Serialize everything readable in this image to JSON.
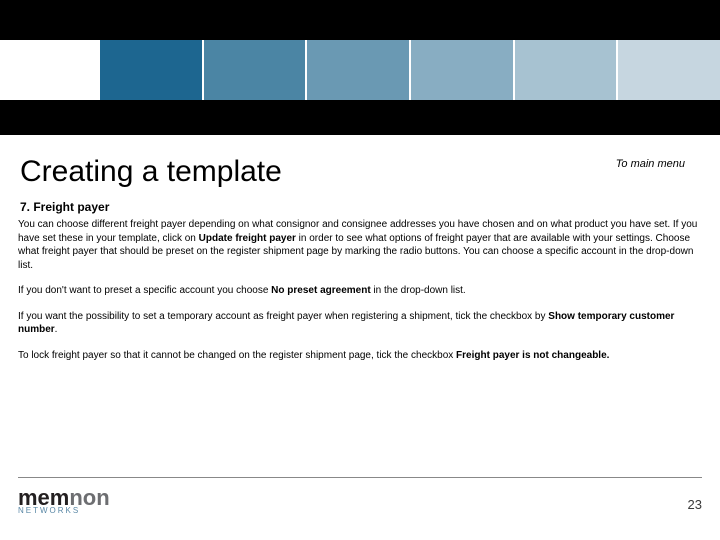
{
  "colors": {
    "seg1": "#1d6690",
    "seg2": "#4b85a4",
    "seg3": "#6a99b3",
    "seg4": "#88adc2",
    "seg5": "#a7c2d1",
    "seg6": "#c6d6e0"
  },
  "header": {
    "title": "Creating a template",
    "menu_link": "To main menu",
    "subheading": "7. Freight payer"
  },
  "body": {
    "p1a": "You can choose different freight payer depending on what consignor and consignee addresses you have chosen and on what product you have set. If you have set these in your template, click on ",
    "p1b": "Update freight payer",
    "p1c": " in order to see what options of freight payer that are available with your settings. Choose what freight payer that should be preset on the register shipment page by marking the radio buttons. You can choose a specific account in the drop-down list.",
    "p2a": "If you don't want to preset a specific account you choose ",
    "p2b": "No preset agreement",
    "p2c": " in the drop-down list.",
    "p3a": "If you want the possibility to set a temporary account as freight payer when registering a shipment, tick the checkbox by ",
    "p3b": "Show temporary customer number",
    "p3c": ".",
    "p4a": "To lock freight payer so that it cannot be changed on the register shipment page, tick the checkbox ",
    "p4b": "Freight payer is not changeable.",
    "p4c": ""
  },
  "footer": {
    "logo_main_dark": "mem",
    "logo_main_grey": "non",
    "logo_sub": "NETWORKS",
    "page_number": "23"
  }
}
